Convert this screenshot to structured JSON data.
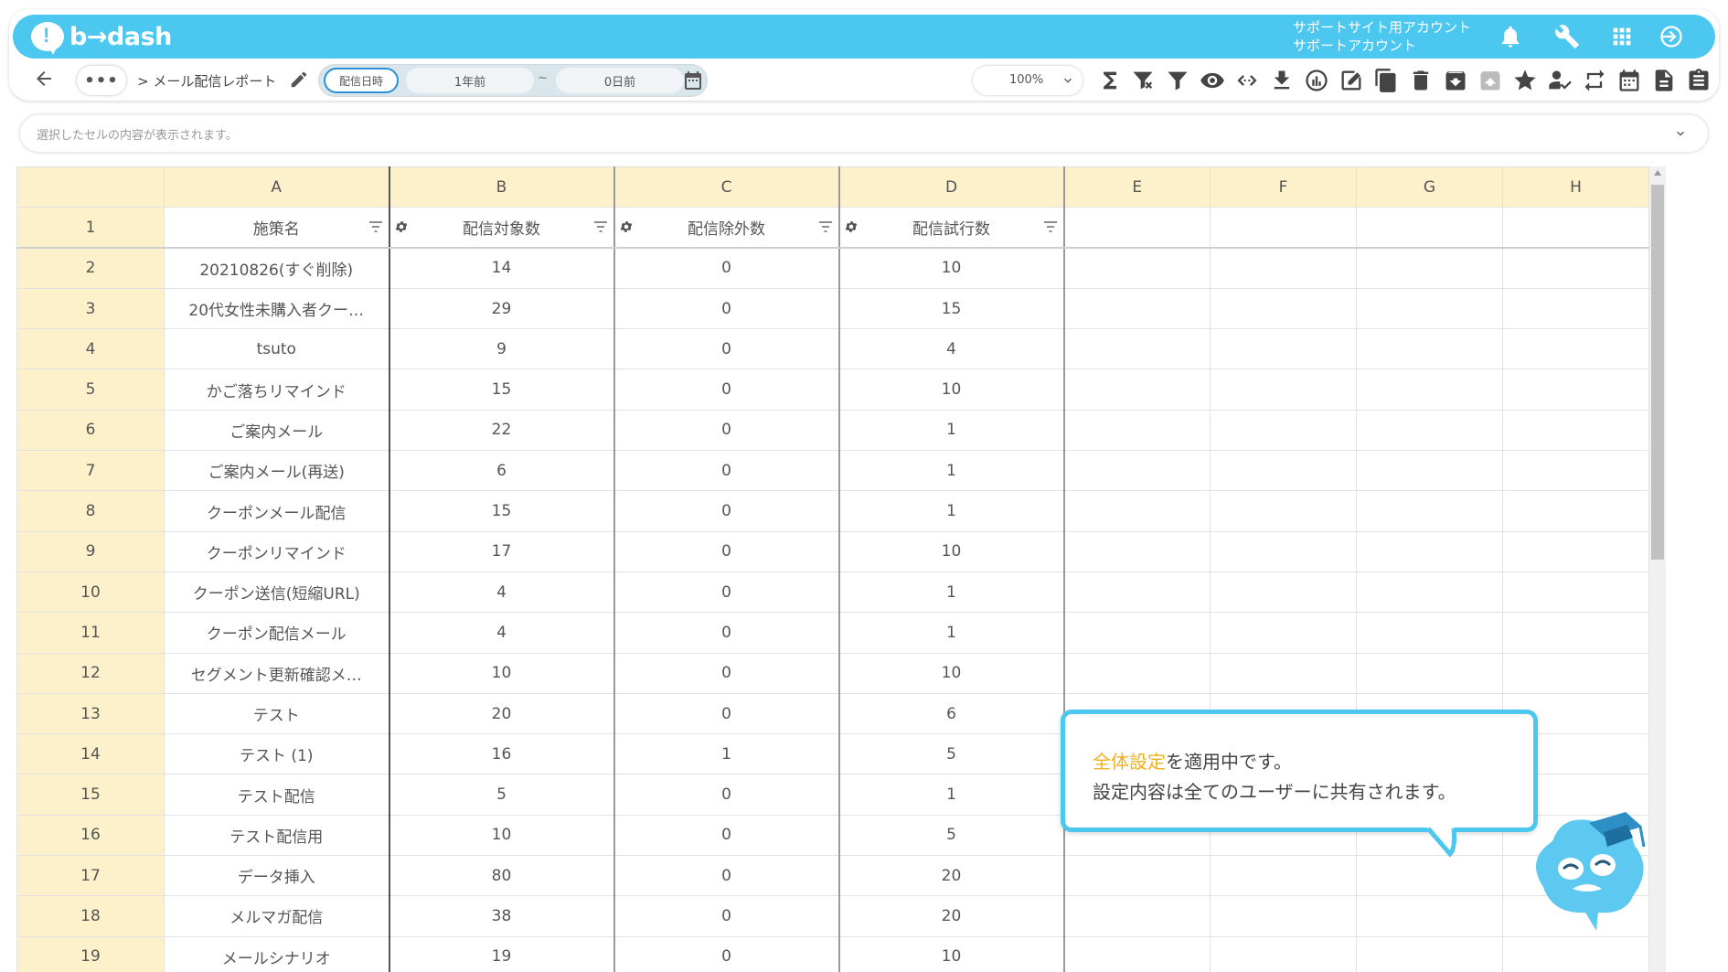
{
  "header": {
    "logo_text": "b→dash",
    "account_line1": "サポートサイト用アカウント",
    "account_line2": "サポートアカウント",
    "icons": [
      "bell-icon",
      "wrench-icon",
      "apps-grid-icon",
      "logout-icon"
    ]
  },
  "toolbar": {
    "dots": "•••",
    "breadcrumb": "> メール配信レポート",
    "date_label": "配信日時",
    "date_from": "1年前",
    "date_sep": "~",
    "date_to": "0日前",
    "zoom": "100%",
    "icons": [
      "sum-icon",
      "filter-clear-icon",
      "filter-icon",
      "eye-icon",
      "code-icon",
      "download-icon",
      "chart-icon",
      "edit-icon",
      "copy-icon",
      "trash-icon",
      "archive-icon",
      "unarchive-icon",
      "star-icon",
      "user-check-icon",
      "refresh-icon",
      "calendar-icon",
      "document-icon",
      "clipboard-icon"
    ]
  },
  "cellbar": {
    "placeholder": "選択したセルの内容が表示されます。"
  },
  "grid": {
    "columns": [
      "A",
      "B",
      "C",
      "D",
      "E",
      "F",
      "G",
      "H"
    ],
    "header_row_num": "1",
    "headers": [
      "施策名",
      "配信対象数",
      "配信除外数",
      "配信試行数"
    ],
    "rows": [
      {
        "n": "2",
        "a": "20210826(すぐ削除)",
        "b": "14",
        "c": "0",
        "d": "10"
      },
      {
        "n": "3",
        "a": "20代女性未購入者クー…",
        "b": "29",
        "c": "0",
        "d": "15"
      },
      {
        "n": "4",
        "a": "tsuto",
        "b": "9",
        "c": "0",
        "d": "4"
      },
      {
        "n": "5",
        "a": "かご落ちリマインド",
        "b": "15",
        "c": "0",
        "d": "10"
      },
      {
        "n": "6",
        "a": "ご案内メール",
        "b": "22",
        "c": "0",
        "d": "1"
      },
      {
        "n": "7",
        "a": "ご案内メール(再送)",
        "b": "6",
        "c": "0",
        "d": "1"
      },
      {
        "n": "8",
        "a": "クーポンメール配信",
        "b": "15",
        "c": "0",
        "d": "1"
      },
      {
        "n": "9",
        "a": "クーポンリマインド",
        "b": "17",
        "c": "0",
        "d": "10"
      },
      {
        "n": "10",
        "a": "クーポン送信(短縮URL)",
        "b": "4",
        "c": "0",
        "d": "1"
      },
      {
        "n": "11",
        "a": "クーポン配信メール",
        "b": "4",
        "c": "0",
        "d": "1"
      },
      {
        "n": "12",
        "a": "セグメント更新確認メ…",
        "b": "10",
        "c": "0",
        "d": "10"
      },
      {
        "n": "13",
        "a": "テスト",
        "b": "20",
        "c": "0",
        "d": "6"
      },
      {
        "n": "14",
        "a": "テスト (1)",
        "b": "16",
        "c": "1",
        "d": "5"
      },
      {
        "n": "15",
        "a": "テスト配信",
        "b": "5",
        "c": "0",
        "d": "1"
      },
      {
        "n": "16",
        "a": "テスト配信用",
        "b": "10",
        "c": "0",
        "d": "5"
      },
      {
        "n": "17",
        "a": "データ挿入",
        "b": "80",
        "c": "0",
        "d": "20"
      },
      {
        "n": "18",
        "a": "メルマガ配信",
        "b": "38",
        "c": "0",
        "d": "20"
      },
      {
        "n": "19",
        "a": "メールシナリオ",
        "b": "19",
        "c": "0",
        "d": "10"
      }
    ]
  },
  "bubble": {
    "highlight": "全体設定",
    "line1_rest": "を適用中です。",
    "line2": "設定内容は全てのユーザーに共有されます。"
  },
  "colors": {
    "brand": "#4cc7ef",
    "header_bg": "#fdf1cc",
    "highlight": "#f2b01e"
  }
}
